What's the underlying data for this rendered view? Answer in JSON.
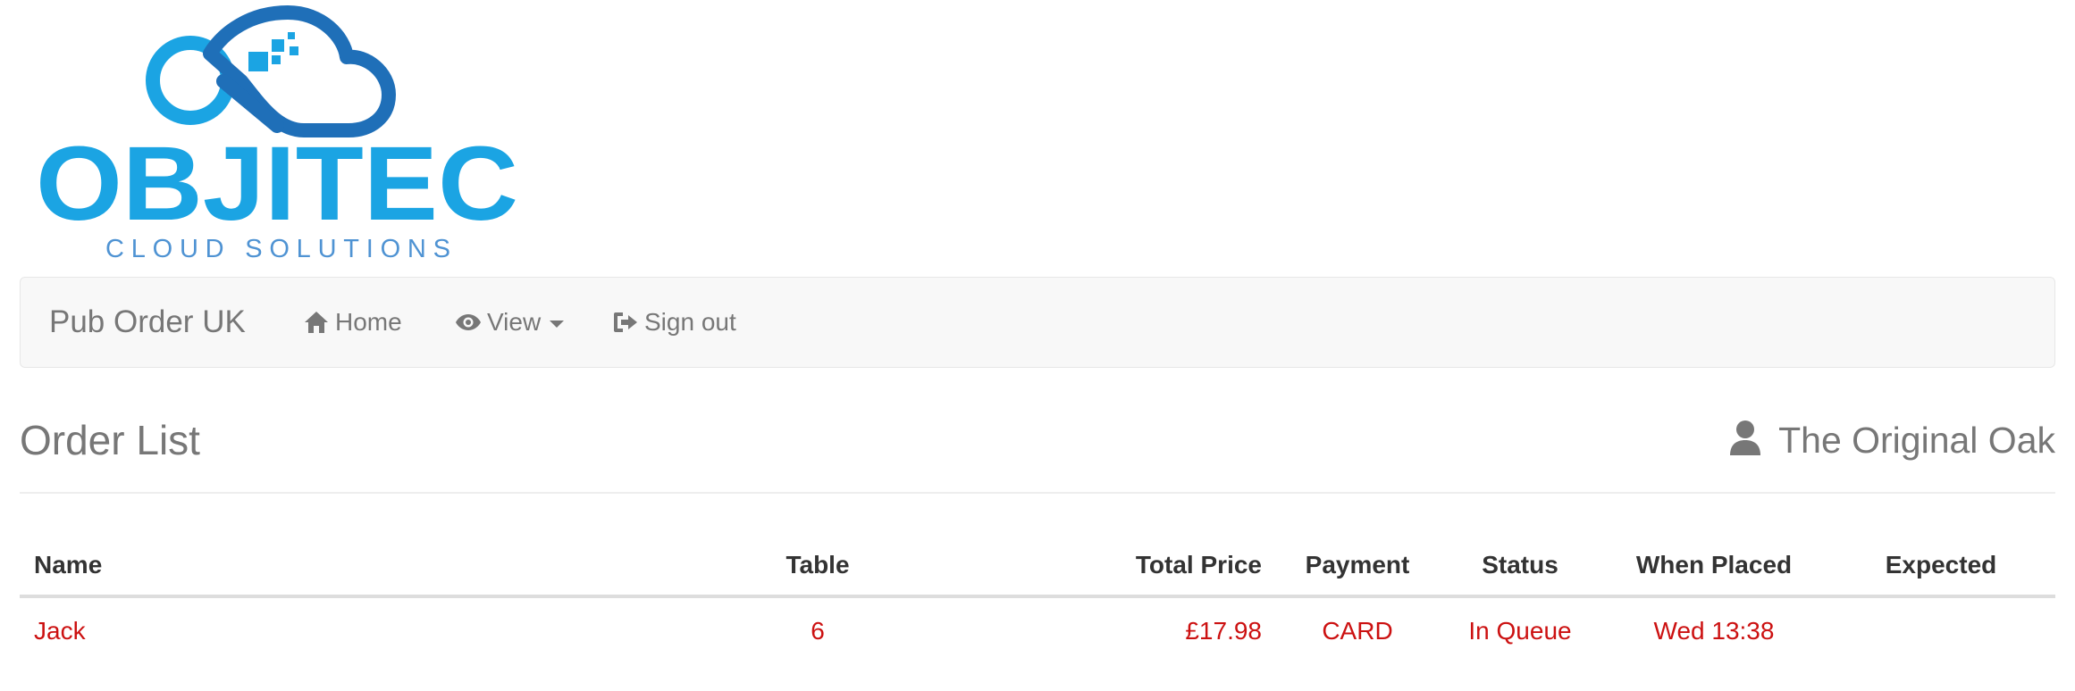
{
  "logo": {
    "wordmark": "OBJITEC",
    "tagline": "CLOUD SOLUTIONS",
    "colors": {
      "light_blue": "#1ba4e3",
      "dark_blue": "#1f6fb8",
      "tagline": "#4f93d3"
    }
  },
  "navbar": {
    "brand": "Pub Order UK",
    "items": [
      {
        "label": "Home",
        "icon": "home-icon"
      },
      {
        "label": "View",
        "icon": "eye-icon",
        "dropdown": true
      },
      {
        "label": "Sign out",
        "icon": "sign-out-icon"
      }
    ]
  },
  "page": {
    "title": "Order List",
    "venue": "The Original Oak",
    "venue_icon": "user-icon"
  },
  "orders_table": {
    "columns": [
      "Name",
      "Table",
      "Total Price",
      "Payment",
      "Status",
      "When Placed",
      "Expected"
    ],
    "rows": [
      {
        "name": "Jack",
        "table": "6",
        "total_price": "£17.98",
        "payment": "CARD",
        "status": "In Queue",
        "when_placed": "Wed 13:38",
        "expected": ""
      }
    ],
    "row_color": "#cc1111"
  }
}
